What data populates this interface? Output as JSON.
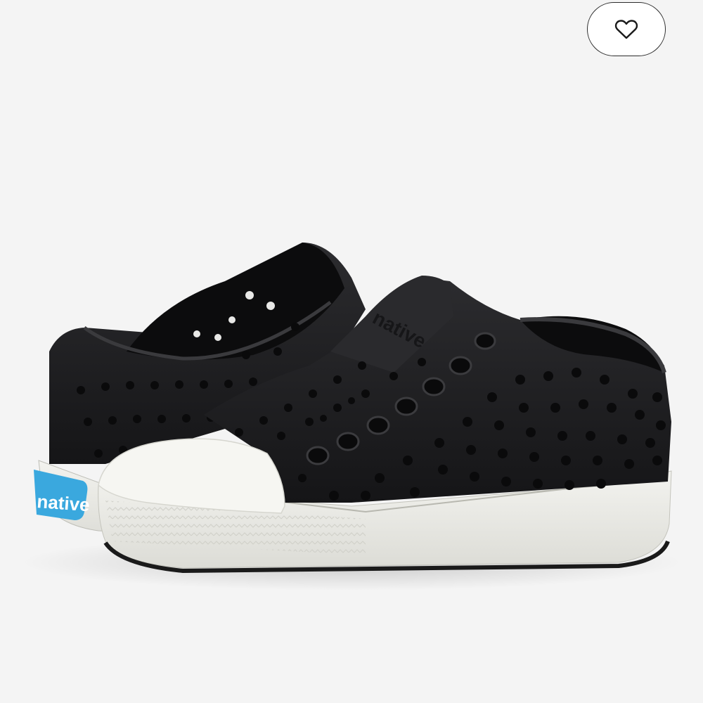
{
  "product": {
    "brand_logo_text": "native",
    "upper_brand_text": "native",
    "colors": {
      "background": "#f4f4f4",
      "upper": "#1e1e20",
      "sole": "#ecece8",
      "toe_cap": "#f6f6f2",
      "heel_badge": "#3aa8de"
    }
  },
  "favorite_button": {
    "icon": "heart-icon"
  }
}
